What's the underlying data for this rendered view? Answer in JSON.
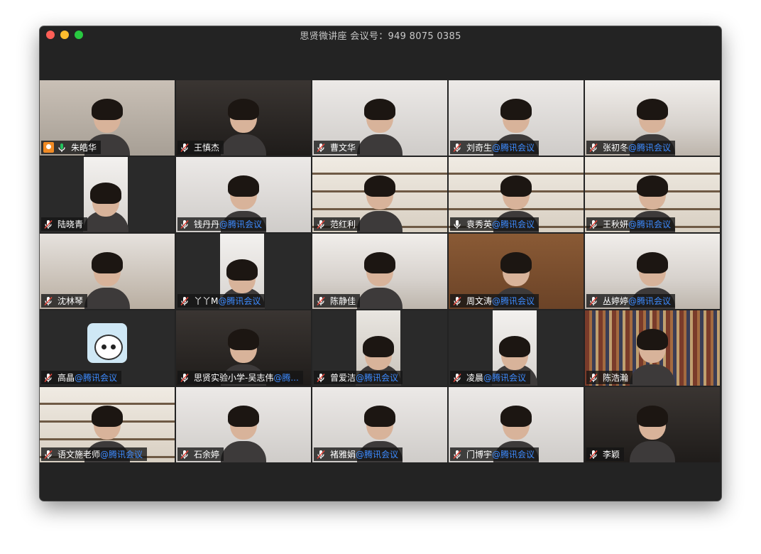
{
  "window": {
    "title": "思贤微讲座 会议号：949 8075 0385"
  },
  "tiles": [
    {
      "name": "朱皓华",
      "suffix": "",
      "host": true,
      "mic": "on",
      "scene": "wall",
      "active": true
    },
    {
      "name": "王慎杰",
      "suffix": "",
      "mic": "muted",
      "scene": "dark"
    },
    {
      "name": "曹文华",
      "suffix": "",
      "mic": "muted",
      "scene": "white"
    },
    {
      "name": "刘奇生",
      "suffix": "@腾讯会议",
      "mic": "muted",
      "scene": "white"
    },
    {
      "name": "张初冬",
      "suffix": "@腾讯会议",
      "mic": "muted",
      "scene": "office"
    },
    {
      "name": "陆晓青",
      "suffix": "",
      "mic": "muted",
      "scene": "inset-white"
    },
    {
      "name": "钱丹丹",
      "suffix": "@腾讯会议",
      "mic": "muted",
      "scene": "white"
    },
    {
      "name": "范红利",
      "suffix": "",
      "mic": "muted",
      "scene": "shelf"
    },
    {
      "name": "袁秀英",
      "suffix": "@腾讯会议",
      "mic": "on",
      "scene": "shelf"
    },
    {
      "name": "王秋妍",
      "suffix": "@腾讯会议",
      "mic": "muted",
      "scene": "shelf"
    },
    {
      "name": "沈林琴",
      "suffix": "",
      "mic": "muted",
      "scene": "room"
    },
    {
      "name": "丫丫M",
      "suffix": "@腾讯会议",
      "mic": "muted",
      "scene": "inset-white"
    },
    {
      "name": "陈静佳",
      "suffix": "",
      "mic": "muted",
      "scene": "office"
    },
    {
      "name": "周文涛",
      "suffix": "@腾讯会议",
      "mic": "muted",
      "scene": "wood"
    },
    {
      "name": "丛婷婷",
      "suffix": "@腾讯会议",
      "mic": "muted",
      "scene": "office"
    },
    {
      "name": "高晶",
      "suffix": "@腾讯会议",
      "mic": "muted",
      "scene": "avatar"
    },
    {
      "name": "思贤实验小学-吴志伟",
      "suffix": "@腾...",
      "mic": "muted",
      "scene": "dark"
    },
    {
      "name": "曾爱洁",
      "suffix": "@腾讯会议",
      "mic": "muted",
      "scene": "inset-room"
    },
    {
      "name": "凌晨",
      "suffix": "@腾讯会议",
      "mic": "muted",
      "scene": "inset-white"
    },
    {
      "name": "陈浩瀚",
      "suffix": "",
      "mic": "muted",
      "scene": "books"
    },
    {
      "name": "语文施老师",
      "suffix": "@腾讯会议",
      "mic": "muted",
      "scene": "shelf"
    },
    {
      "name": "石余婷",
      "suffix": "",
      "mic": "muted",
      "scene": "white"
    },
    {
      "name": "褚雅娟",
      "suffix": "@腾讯会议",
      "mic": "muted",
      "scene": "white"
    },
    {
      "name": "门博宇",
      "suffix": "@腾讯会议",
      "mic": "muted",
      "scene": "white"
    },
    {
      "name": "李颖",
      "suffix": "",
      "mic": "muted",
      "scene": "dark"
    }
  ]
}
